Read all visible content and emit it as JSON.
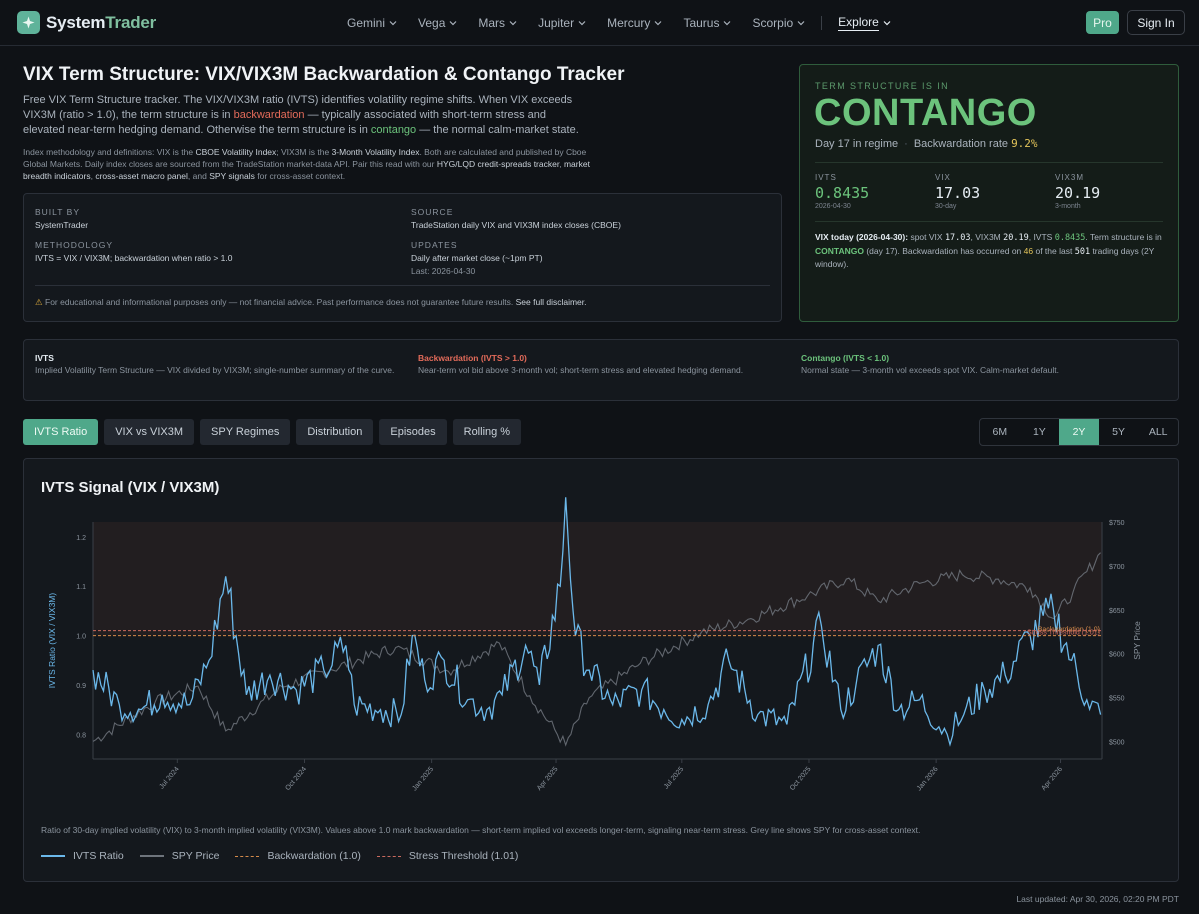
{
  "brand": {
    "part1": "System",
    "part2": "Trader"
  },
  "nav": {
    "items": [
      "Gemini",
      "Vega",
      "Mars",
      "Jupiter",
      "Mercury",
      "Taurus",
      "Scorpio"
    ],
    "explore": "Explore",
    "pro": "Pro",
    "signin": "Sign In"
  },
  "hero": {
    "title": "VIX Term Structure: VIX/VIX3M Backwardation & Contango Tracker",
    "desc_a": "Free VIX Term Structure tracker. The VIX/VIX3M ratio (IVTS) identifies volatility regime shifts. When VIX exceeds VIX3M (ratio > 1.0), the term structure is in ",
    "desc_bw": "backwardation",
    "desc_b": " — typically associated with short-term stress and elevated near-term hedging demand. Otherwise the term structure is in ",
    "desc_cg": "contango",
    "desc_c": " — the normal calm-market state.",
    "meth_a": "Index methodology and definitions: VIX is the ",
    "meth_vix": "CBOE Volatility Index",
    "meth_b": "; VIX3M is the ",
    "meth_vix3m": "3-Month Volatility Index",
    "meth_c": ". Both are calculated and published by Cboe Global Markets. Daily index closes are sourced from the TradeStation market-data API. Pair this read with our ",
    "meth_hyg": "HYG/LQD credit-spreads tracker",
    "meth_d": ", ",
    "meth_breadth": "market breadth indicators",
    "meth_e": ", ",
    "meth_macro": "cross-asset macro panel",
    "meth_f": ", and ",
    "meth_spy": "SPY signals",
    "meth_g": " for cross-asset context."
  },
  "info": {
    "built_by_label": "Built by",
    "built_by": "SystemTrader",
    "source_label": "Source",
    "source": "TradeStation daily VIX and VIX3M index closes (CBOE)",
    "methodology_label": "Methodology",
    "methodology": "IVTS = VIX / VIX3M; backwardation when ratio > 1.0",
    "updates_label": "Updates",
    "updates": "Daily after market close (~1pm PT)",
    "last": "Last: 2026-04-30",
    "disclaimer": "For educational and informational purposes only — not financial advice. Past performance does not guarantee future results.",
    "disclaimer_link": "See full disclaimer."
  },
  "regime": {
    "eyebrow": "Term structure is in",
    "state": "CONTANGO",
    "day": "Day 17 in regime",
    "bw_rate_label": "Backwardation rate",
    "bw_rate": "9.2%",
    "stats": [
      {
        "label": "IVTS",
        "value": "0.8435",
        "sub": "2026-04-30"
      },
      {
        "label": "VIX",
        "value": "17.03",
        "sub": "30-day"
      },
      {
        "label": "VIX3M",
        "value": "20.19",
        "sub": "3-month"
      }
    ],
    "today_label": "VIX today (2026-04-30):",
    "t1": " spot VIX ",
    "t_vix": "17.03",
    "t2": ", VIX3M ",
    "t_vix3m": "20.19",
    "t3": ", IVTS ",
    "t_ivts": "0.8435",
    "t4": ". Term structure is in ",
    "t_state": "CONTANGO",
    "t5": " (day 17). Backwardation has occurred on ",
    "t_count": "46",
    "t6": " of the last ",
    "t_total": "501",
    "t7": " trading days (2Y window)."
  },
  "definitions": [
    {
      "term": "IVTS",
      "desc": "Implied Volatility Term Structure — VIX divided by VIX3M; single-number summary of the curve.",
      "color": "#e6edf3"
    },
    {
      "term": "Backwardation (IVTS > 1.0)",
      "desc": "Near-term vol bid above 3-month vol; short-term stress and elevated hedging demand.",
      "color": "#e36b5a"
    },
    {
      "term": "Contango (IVTS < 1.0)",
      "desc": "Normal state — 3-month vol exceeds spot VIX. Calm-market default.",
      "color": "#6cc37c"
    }
  ],
  "tabs": [
    "IVTS Ratio",
    "VIX vs VIX3M",
    "SPY Regimes",
    "Distribution",
    "Episodes",
    "Rolling %"
  ],
  "active_tab": "IVTS Ratio",
  "ranges": [
    "6M",
    "1Y",
    "2Y",
    "5Y",
    "ALL"
  ],
  "active_range": "2Y",
  "chart_title": "IVTS Signal (VIX / VIX3M)",
  "chart_caption": "Ratio of 30-day implied volatility (VIX) to 3-month implied volatility (VIX3M). Values above 1.0 mark backwardation — short-term implied vol exceeds longer-term, signaling near-term stress. Grey line shows SPY for cross-asset context.",
  "updated": "Last updated: Apr 30, 2026, 02:20 PM PDT",
  "colors": {
    "accent": "#4fa88a",
    "contango": "#6cc37c",
    "backwardation": "#e36b5a",
    "ivts_line": "#6bb8ea",
    "spy_line": "#6e747c"
  },
  "chart_data": {
    "type": "line",
    "title": "IVTS Signal (VIX / VIX3M)",
    "ylabel": "IVTS Ratio (VIX / VIX3M)",
    "y2label": "SPY Price",
    "ylim": [
      0.75,
      1.23
    ],
    "y2lim": [
      480,
      750
    ],
    "yticks": [
      0.8,
      0.9,
      1.0,
      1.1,
      1.2
    ],
    "y2ticks": [
      "$500",
      "$550",
      "$600",
      "$650",
      "$700",
      "$750"
    ],
    "y2tick_values": [
      500,
      550,
      600,
      650,
      700,
      750
    ],
    "xlim": [
      "2024-05-01",
      "2026-05-01"
    ],
    "xticks": [
      {
        "label": "Jul 2024",
        "date": "2024-07-01"
      },
      {
        "label": "Oct 2024",
        "date": "2024-10-01"
      },
      {
        "label": "Jan 2025",
        "date": "2025-01-01"
      },
      {
        "label": "Apr 2025",
        "date": "2025-04-01"
      },
      {
        "label": "Jul 2025",
        "date": "2025-07-01"
      },
      {
        "label": "Oct 2025",
        "date": "2025-10-01"
      },
      {
        "label": "Jan 2026",
        "date": "2026-01-01"
      },
      {
        "label": "Apr 2026",
        "date": "2026-04-01"
      }
    ],
    "series": [
      {
        "name": "IVTS Ratio",
        "axis": "left",
        "x": [
          "2024-05-01",
          "2024-05-20",
          "2024-06-05",
          "2024-06-20",
          "2024-07-10",
          "2024-07-24",
          "2024-08-05",
          "2024-08-20",
          "2024-09-06",
          "2024-09-25",
          "2024-10-15",
          "2024-10-31",
          "2024-11-06",
          "2024-11-25",
          "2024-12-10",
          "2024-12-18",
          "2024-12-27",
          "2025-01-10",
          "2025-01-27",
          "2025-02-10",
          "2025-02-21",
          "2025-03-10",
          "2025-03-20",
          "2025-04-04",
          "2025-04-08",
          "2025-04-15",
          "2025-04-25",
          "2025-05-12",
          "2025-06-02",
          "2025-06-18",
          "2025-07-01",
          "2025-07-20",
          "2025-08-04",
          "2025-08-25",
          "2025-09-15",
          "2025-10-10",
          "2025-10-24",
          "2025-11-04",
          "2025-11-20",
          "2025-12-05",
          "2025-12-20",
          "2026-01-09",
          "2026-01-21",
          "2026-02-05",
          "2026-02-20",
          "2026-03-10",
          "2026-03-27",
          "2026-04-09",
          "2026-04-20",
          "2026-04-30"
        ],
        "y": [
          0.93,
          0.86,
          0.85,
          0.88,
          0.86,
          0.95,
          1.12,
          0.88,
          0.92,
          0.89,
          0.93,
          0.98,
          0.86,
          0.85,
          0.84,
          1.0,
          0.91,
          0.95,
          0.87,
          0.85,
          0.88,
          0.98,
          0.9,
          1.1,
          1.28,
          1.0,
          0.93,
          0.86,
          0.89,
          0.85,
          0.83,
          0.86,
          0.95,
          0.84,
          0.82,
          1.02,
          0.85,
          0.9,
          0.98,
          0.85,
          0.87,
          0.8,
          0.84,
          0.89,
          0.92,
          1.0,
          1.05,
          0.95,
          0.87,
          0.84
        ]
      },
      {
        "name": "SPY Price",
        "axis": "right",
        "x": [
          "2024-05-01",
          "2024-06-15",
          "2024-07-16",
          "2024-08-05",
          "2024-09-15",
          "2024-10-20",
          "2024-12-06",
          "2025-01-13",
          "2025-02-19",
          "2025-03-13",
          "2025-04-08",
          "2025-04-25",
          "2025-06-01",
          "2025-07-15",
          "2025-08-20",
          "2025-09-30",
          "2025-10-28",
          "2025-11-20",
          "2025-12-20",
          "2026-01-20",
          "2026-02-15",
          "2026-03-10",
          "2026-03-27",
          "2026-04-10",
          "2026-04-30"
        ],
        "y": [
          500,
          545,
          563,
          512,
          562,
          582,
          607,
          580,
          612,
          552,
          496,
          550,
          589,
          624,
          640,
          666,
          685,
          660,
          680,
          690,
          685,
          675,
          640,
          670,
          715
        ]
      },
      {
        "name": "Backwardation (1.0)",
        "axis": "left",
        "constant": 1.0
      },
      {
        "name": "Stress Threshold (1.01)",
        "axis": "left",
        "constant": 1.01
      }
    ],
    "legend_position": "bottom-left",
    "grid": false
  }
}
